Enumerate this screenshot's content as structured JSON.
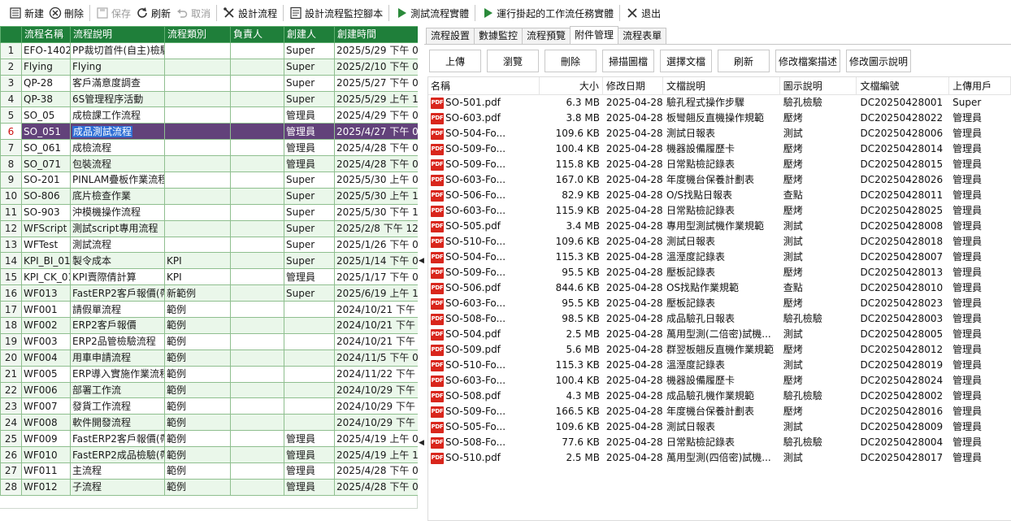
{
  "toolbar": {
    "new": "新建",
    "delete": "刪除",
    "save": "保存",
    "refresh": "刷新",
    "cancel": "取消",
    "design_flow": "設計流程",
    "design_monitor_script": "設計流程監控腳本",
    "test_instance": "測試流程實體",
    "run_pending": "運行掛起的工作流任務實體",
    "exit": "退出"
  },
  "grid": {
    "columns": [
      "",
      "流程名稱",
      "流程說明",
      "流程類別",
      "負責人",
      "創建人",
      "創建時間"
    ],
    "selected_row": 6,
    "rows": [
      [
        "1",
        "EFO-1402",
        "PP裁切首件(自主)檢驗",
        "",
        "",
        "Super",
        "2025/5/29 下午 0"
      ],
      [
        "2",
        "Flying",
        "Flying",
        "",
        "",
        "Super",
        "2025/2/10 下午 0"
      ],
      [
        "3",
        "QP-28",
        "客戶滿意度調查",
        "",
        "",
        "Super",
        "2025/5/27 下午 0"
      ],
      [
        "4",
        "QP-38",
        "6S管理程序活動",
        "",
        "",
        "Super",
        "2025/5/29 上午 1"
      ],
      [
        "5",
        "SO_05",
        "成檢課工作流程",
        "",
        "",
        "管理員",
        "2025/4/29 下午 0"
      ],
      [
        "6",
        "SO_051",
        "成品測試流程",
        "",
        "",
        "管理員",
        "2025/4/27 下午 0"
      ],
      [
        "7",
        "SO_061",
        "成檢流程",
        "",
        "",
        "管理員",
        "2025/4/28 下午 0"
      ],
      [
        "8",
        "SO_071",
        "包裝流程",
        "",
        "",
        "管理員",
        "2025/4/28 下午 0"
      ],
      [
        "9",
        "SO-201",
        "PINLAM疊板作業流程",
        "",
        "",
        "Super",
        "2025/5/30 上午 0"
      ],
      [
        "10",
        "SO-806",
        "底片檢查作業",
        "",
        "",
        "Super",
        "2025/5/30 上午 1"
      ],
      [
        "11",
        "SO-903",
        "沖模機操作流程",
        "",
        "",
        "Super",
        "2025/5/30 下午 1"
      ],
      [
        "12",
        "WFScript",
        "測試script專用流程",
        "",
        "",
        "Super",
        "2025/2/8 下午 12"
      ],
      [
        "13",
        "WFTest",
        "測試流程",
        "",
        "",
        "Super",
        "2025/1/26 下午 0"
      ],
      [
        "14",
        "KPI_BI_01",
        "製令成本",
        "KPI",
        "",
        "Super",
        "2025/1/14 下午 0"
      ],
      [
        "15",
        "KPI_CK_01",
        "KPI賣際倩計算",
        "KPI",
        "",
        "管理員",
        "2025/1/17 下午 0"
      ],
      [
        "16",
        "WF013",
        "FastERP2客戶報價(帶",
        "新範例",
        "",
        "Super",
        "2025/6/19 上午 1"
      ],
      [
        "17",
        "WF001",
        "請假單流程",
        "範例",
        "",
        "",
        "2024/10/21 下午"
      ],
      [
        "18",
        "WF002",
        "ERP2客戶報價",
        "範例",
        "",
        "",
        "2024/10/21 下午"
      ],
      [
        "19",
        "WF003",
        "ERP2品管檢驗流程",
        "範例",
        "",
        "",
        "2024/10/21 下午"
      ],
      [
        "20",
        "WF004",
        "用車申請流程",
        "範例",
        "",
        "",
        "2024/11/5 下午 0"
      ],
      [
        "21",
        "WF005",
        "ERP導入實施作業流程",
        "範例",
        "",
        "",
        "2024/11/22 下午"
      ],
      [
        "22",
        "WF006",
        "部署工作流",
        "範例",
        "",
        "",
        "2024/10/29 下午"
      ],
      [
        "23",
        "WF007",
        "發貨工作流程",
        "範例",
        "",
        "",
        "2024/10/29 下午"
      ],
      [
        "24",
        "WF008",
        "軟件開發流程",
        "範例",
        "",
        "",
        "2024/10/29 下午"
      ],
      [
        "25",
        "WF009",
        "FastERP2客戶報價(帶",
        "範例",
        "",
        "管理員",
        "2025/4/19 上午 0"
      ],
      [
        "26",
        "WF010",
        "FastERP2成品檢驗(帶",
        "範例",
        "",
        "管理員",
        "2025/4/19 上午 1"
      ],
      [
        "27",
        "WF011",
        "主流程",
        "範例",
        "",
        "管理員",
        "2025/4/28 下午 0"
      ],
      [
        "28",
        "WF012",
        "子流程",
        "範例",
        "",
        "管理員",
        "2025/4/28 下午 0"
      ]
    ]
  },
  "right": {
    "tabs": [
      "流程設置",
      "數據監控",
      "流程預覽",
      "附件管理",
      "流程表單"
    ],
    "active_tab": 3,
    "actions": [
      "上傳",
      "瀏覽",
      "刪除",
      "掃描圖檔",
      "選擇文檔",
      "刷新",
      "修改檔案描述",
      "修改圖示說明"
    ],
    "file_columns": [
      "名稱",
      "大小",
      "修改日期",
      "文檔說明",
      "圖示說明",
      "文檔編號",
      "上傳用戶"
    ],
    "files": [
      [
        "SO-501.pdf",
        "6.3 MB",
        "2025-04-28",
        "驗孔程式操作步驟",
        "驗孔檢驗",
        "DC20250428001",
        "Super"
      ],
      [
        "SO-603.pdf",
        "3.8 MB",
        "2025-04-28",
        "板彎翹反直機操作規範",
        "壓烤",
        "DC20250428022",
        "管理員"
      ],
      [
        "SO-504-Fo...",
        "109.6 KB",
        "2025-04-28",
        "測試日報表",
        "測試",
        "DC20250428006",
        "管理員"
      ],
      [
        "SO-509-Fo...",
        "100.4 KB",
        "2025-04-28",
        "機器設備履歷卡",
        "壓烤",
        "DC20250428014",
        "管理員"
      ],
      [
        "SO-509-Fo...",
        "115.8 KB",
        "2025-04-28",
        "日常點檢記錄表",
        "壓烤",
        "DC20250428015",
        "管理員"
      ],
      [
        "SO-603-Fo...",
        "167.0 KB",
        "2025-04-28",
        "年度機台保養計劃表",
        "壓烤",
        "DC20250428026",
        "管理員"
      ],
      [
        "SO-506-Fo...",
        "82.9 KB",
        "2025-04-28",
        "O/S找點日報表",
        "查點",
        "DC20250428011",
        "管理員"
      ],
      [
        "SO-603-Fo...",
        "115.9 KB",
        "2025-04-28",
        "日常點檢記錄表",
        "壓烤",
        "DC20250428025",
        "管理員"
      ],
      [
        "SO-505.pdf",
        "3.4 MB",
        "2025-04-28",
        "專用型測試機作業規範",
        "測試",
        "DC20250428008",
        "管理員"
      ],
      [
        "SO-510-Fo...",
        "109.6 KB",
        "2025-04-28",
        "測試日報表",
        "測試",
        "DC20250428018",
        "管理員"
      ],
      [
        "SO-504-Fo...",
        "115.3 KB",
        "2025-04-28",
        "溫溼度記錄表",
        "測試",
        "DC20250428007",
        "管理員"
      ],
      [
        "SO-509-Fo...",
        "95.5 KB",
        "2025-04-28",
        "壓板記錄表",
        "壓烤",
        "DC20250428013",
        "管理員"
      ],
      [
        "SO-506.pdf",
        "844.6 KB",
        "2025-04-28",
        "OS找點作業規範",
        "查點",
        "DC20250428010",
        "管理員"
      ],
      [
        "SO-603-Fo...",
        "95.5 KB",
        "2025-04-28",
        "壓板記錄表",
        "壓烤",
        "DC20250428023",
        "管理員"
      ],
      [
        "SO-508-Fo...",
        "98.5 KB",
        "2025-04-28",
        "成品驗孔日報表",
        "驗孔檢驗",
        "DC20250428003",
        "管理員"
      ],
      [
        "SO-504.pdf",
        "2.5 MB",
        "2025-04-28",
        "萬用型測(二倍密)試機...",
        "測試",
        "DC20250428005",
        "管理員"
      ],
      [
        "SO-509.pdf",
        "5.6 MB",
        "2025-04-28",
        "群翌板翹反直機作業規範",
        "壓烤",
        "DC20250428012",
        "管理員"
      ],
      [
        "SO-510-Fo...",
        "115.3 KB",
        "2025-04-28",
        "溫溼度記錄表",
        "測試",
        "DC20250428019",
        "管理員"
      ],
      [
        "SO-603-Fo...",
        "100.4 KB",
        "2025-04-28",
        "機器設備履歷卡",
        "壓烤",
        "DC20250428024",
        "管理員"
      ],
      [
        "SO-508.pdf",
        "4.3 MB",
        "2025-04-28",
        "成品驗孔機作業規範",
        "驗孔檢驗",
        "DC20250428002",
        "管理員"
      ],
      [
        "SO-509-Fo...",
        "166.5 KB",
        "2025-04-28",
        "年度機台保養計劃表",
        "壓烤",
        "DC20250428016",
        "管理員"
      ],
      [
        "SO-505-Fo...",
        "109.6 KB",
        "2025-04-28",
        "測試日報表",
        "測試",
        "DC20250428009",
        "管理員"
      ],
      [
        "SO-508-Fo...",
        "77.6 KB",
        "2025-04-28",
        "日常點檢記錄表",
        "驗孔檢驗",
        "DC20250428004",
        "管理員"
      ],
      [
        "SO-510.pdf",
        "2.5 MB",
        "2025-04-28",
        "萬用型測(四倍密)試機...",
        "測試",
        "DC20250428017",
        "管理員"
      ]
    ],
    "pdf_badge": "PDF"
  },
  "colors": {
    "grid_header": "#1f7f3a",
    "grid_alt_row": "#eaf7ea",
    "selected_row": "#62427a",
    "pdf_red": "#d9261c"
  },
  "icons": [
    "new-icon",
    "delete-icon",
    "save-icon",
    "refresh-icon",
    "cancel-icon",
    "design-flow-icon",
    "monitor-script-icon",
    "play-icon",
    "run-play-icon",
    "exit-icon",
    "pdf-icon"
  ]
}
